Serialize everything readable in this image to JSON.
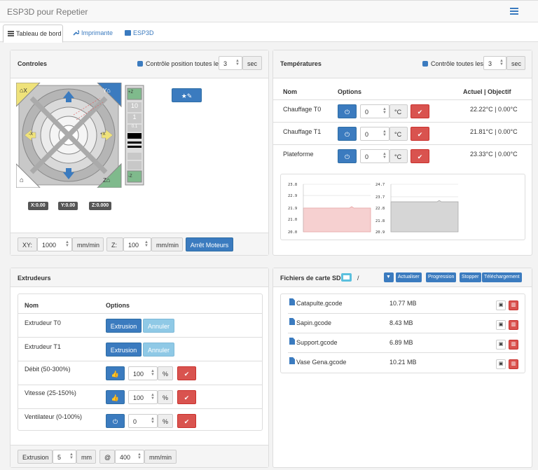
{
  "app": {
    "title": "ESP3D pour Repetier",
    "menu_icon": "hamburger-icon"
  },
  "tabs": [
    {
      "label": "Tableau de bord",
      "icon": "dashboard-icon"
    },
    {
      "label": "Imprimante",
      "icon": "wrench-icon"
    },
    {
      "label": "ESP3D",
      "icon": "printer-icon"
    }
  ],
  "controls": {
    "title": "Controles",
    "poll_label": "Contrôle position toutes les:",
    "poll_value": "3",
    "poll_unit": "sec",
    "jog": {
      "home_x": "X",
      "home_y": "Y",
      "home_z": "Z",
      "plus_x": "+X",
      "minus_x": "-X",
      "plus_y": "+Y",
      "minus_y": "-Y",
      "z_steps": [
        "10",
        "1",
        "0.1"
      ],
      "plus_z": "+Z",
      "minus_z": "-Z"
    },
    "coords": {
      "x": "X:0.00",
      "y": "Y:0.00",
      "z": "Z:0.000"
    },
    "xy_label": "XY:",
    "xy_value": "1000",
    "xy_unit": "mm/min",
    "z_label": "Z:",
    "z_value": "100",
    "z_unit": "mm/min",
    "stop_motors": "Arrêt Moteurs"
  },
  "temps": {
    "title": "Températures",
    "poll_label": "Contrôle toutes les:",
    "poll_value": "3",
    "poll_unit": "sec",
    "headers": {
      "name": "Nom",
      "options": "Options",
      "current": "Actuel | Objectif"
    },
    "rows": [
      {
        "name": "Chauffage T0",
        "value": "0",
        "unit": "°C",
        "current": "22.22°C | 0.00°C"
      },
      {
        "name": "Chauffage T1",
        "value": "0",
        "unit": "°C",
        "current": "21.81°C | 0.00°C"
      },
      {
        "name": "Plateforme",
        "value": "0",
        "unit": "°C",
        "current": "23.33°C | 0.00°C"
      }
    ],
    "chart1": {
      "ticks": [
        "23.8",
        "22.9",
        "21.9",
        "21.0",
        "20.0"
      ],
      "value": 21.9,
      "color": "#f6d0d0",
      "line": "#e8a3a3"
    },
    "chart2": {
      "ticks": [
        "24.7",
        "23.7",
        "22.8",
        "21.8",
        "20.9"
      ],
      "value": 23.3,
      "color": "#d6d6d6",
      "line": "#aaaaaa"
    }
  },
  "extruders": {
    "title": "Extrudeurs",
    "headers": {
      "name": "Nom",
      "options": "Options"
    },
    "rows": [
      {
        "name": "Extrudeur T0",
        "btn": "Extrusion",
        "cancel": "Annuler"
      },
      {
        "name": "Extrudeur T1",
        "btn": "Extrusion",
        "cancel": "Annuler"
      }
    ],
    "sliders": [
      {
        "name": "Débit (50-300%)",
        "value": "100",
        "unit": "%"
      },
      {
        "name": "Vitesse (25-150%)",
        "value": "100",
        "unit": "%"
      },
      {
        "name": "Ventilateur (0-100%)",
        "value": "0",
        "unit": "%"
      }
    ],
    "footer": {
      "label": "Extrusion",
      "value": "5",
      "unit": "mm",
      "at": "@",
      "speed": "400",
      "speed_unit": "mm/min"
    }
  },
  "sd": {
    "title": "Fichiers de carte SD",
    "path": "/",
    "buttons": [
      "Actualiser",
      "Progression",
      "Stopper",
      "Téléchargement"
    ],
    "files": [
      {
        "name": "Catapulte.gcode",
        "size": "10.77 MB"
      },
      {
        "name": "Sapin.gcode",
        "size": "8.43 MB"
      },
      {
        "name": "Support.gcode",
        "size": "6.89 MB"
      },
      {
        "name": "Vase Gena.gcode",
        "size": "10.21 MB"
      }
    ]
  }
}
